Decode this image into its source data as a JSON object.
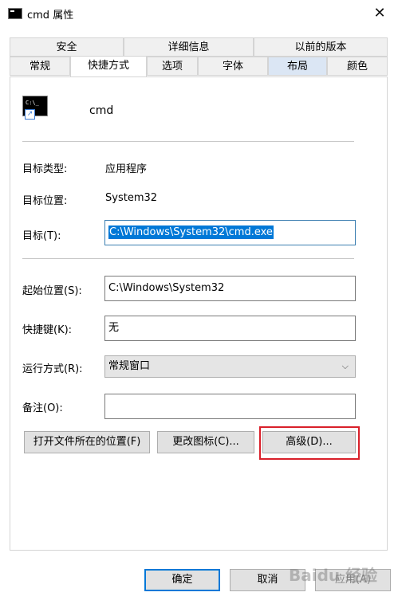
{
  "window": {
    "title": "cmd 属性",
    "close_glyph": "✕"
  },
  "tabs_row1": [
    "安全",
    "详细信息",
    "以前的版本"
  ],
  "tabs_row2": [
    "常规",
    "快捷方式",
    "选项",
    "字体",
    "布局",
    "颜色"
  ],
  "shortcut": {
    "name": "cmd",
    "icon_text": "C:\\_",
    "target_type_label": "目标类型:",
    "target_type_value": "应用程序",
    "target_location_label": "目标位置:",
    "target_location_value": "System32",
    "target_label": "目标(T):",
    "target_value": "C:\\Windows\\System32\\cmd.exe",
    "start_in_label": "起始位置(S):",
    "start_in_value": "C:\\Windows\\System32",
    "hotkey_label": "快捷键(K):",
    "hotkey_value": "无",
    "run_label": "运行方式(R):",
    "run_value": "常规窗口",
    "comment_label": "备注(O):",
    "comment_value": ""
  },
  "buttons": {
    "open_location": "打开文件所在的位置(F)",
    "change_icon": "更改图标(C)...",
    "advanced": "高级(D)...",
    "ok": "确定",
    "cancel": "取消",
    "apply": "应用(A)"
  },
  "watermark": "Baidu 经验"
}
